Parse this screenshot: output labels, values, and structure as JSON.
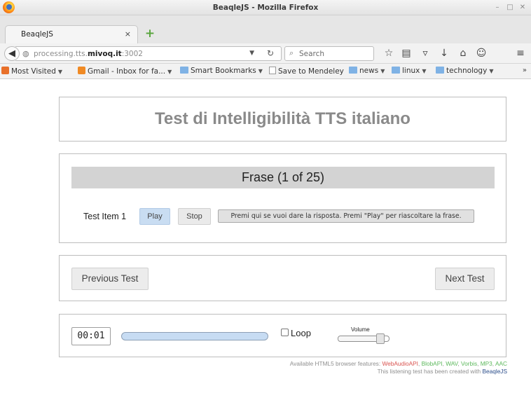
{
  "window": {
    "title": "BeaqleJS - Mozilla Firefox"
  },
  "tab": {
    "label": "BeaqleJS",
    "close": "×"
  },
  "navbar": {
    "url_prefix": "processing.tts.",
    "url_domain": "mivoq.it",
    "url_suffix": ":3002",
    "search_placeholder": "Search"
  },
  "bookmarks": [
    {
      "label": "Most Visited",
      "icon": "most-visited-icon",
      "dropdown": true
    },
    {
      "label": "Gmail - Inbox for fa...",
      "icon": "rss-icon",
      "dropdown": true
    },
    {
      "label": "Smart Bookmarks",
      "icon": "folder-icon",
      "dropdown": true
    },
    {
      "label": "Save to Mendeley",
      "icon": "page-icon",
      "dropdown": false
    },
    {
      "label": "news",
      "icon": "folder-icon",
      "dropdown": true
    },
    {
      "label": "linux",
      "icon": "folder-icon",
      "dropdown": true
    },
    {
      "label": "technology",
      "icon": "folder-icon",
      "dropdown": true
    }
  ],
  "page": {
    "title": "Test di Intelligibilità TTS italiano",
    "frase_header": "Frase (1 of 25)",
    "item_label": "Test Item 1",
    "play_label": "Play",
    "stop_label": "Stop",
    "answer_label": "Premi qui se vuoi dare la risposta. Premi \"Play\" per riascoltare la frase.",
    "prev_label": "Previous Test",
    "next_label": "Next Test",
    "time": "00:01",
    "loop_label": "Loop",
    "volume_label": "Volume",
    "volume_level": 0.9,
    "footer_prefix": "Available HTML5 browser features: ",
    "features": [
      {
        "name": "WebAudioAPI",
        "color": "#d9534f"
      },
      {
        "name": "BlobAPI",
        "color": "#5cb85c"
      },
      {
        "name": "WAV",
        "color": "#5cb85c"
      },
      {
        "name": "Vorbis",
        "color": "#5cb85c"
      },
      {
        "name": "MP3",
        "color": "#5cb85c"
      },
      {
        "name": "AAC",
        "color": "#5cb85c"
      }
    ],
    "footer_created": "This listening test has been created with ",
    "footer_link": "BeaqleJS"
  }
}
